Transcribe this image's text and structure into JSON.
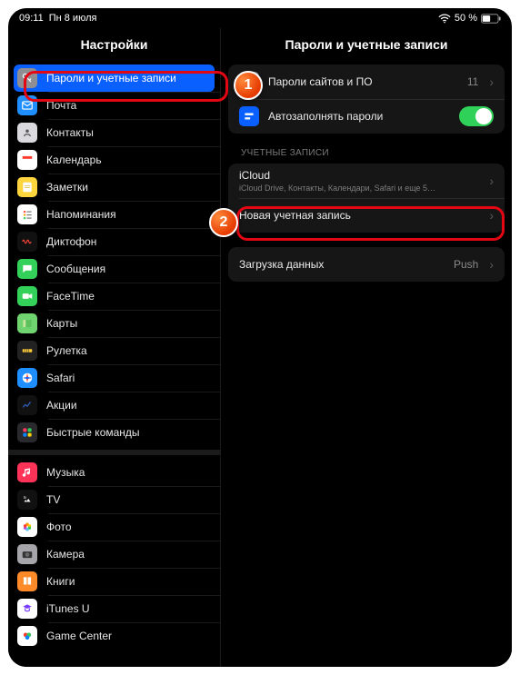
{
  "status": {
    "time": "09:11",
    "date": "Пн 8 июля",
    "battery": "50 %"
  },
  "sidebar": {
    "title": "Настройки",
    "items": [
      {
        "label": "Пароли и учетные записи",
        "icon": "key",
        "bg": "#8e8e93",
        "selected": true
      },
      {
        "label": "Почта",
        "icon": "mail",
        "bg": "#1f8fff"
      },
      {
        "label": "Контакты",
        "icon": "contacts",
        "bg": "#d9d9de"
      },
      {
        "label": "Календарь",
        "icon": "calendar",
        "bg": "#ffffff"
      },
      {
        "label": "Заметки",
        "icon": "notes",
        "bg": "#ffd53d"
      },
      {
        "label": "Напоминания",
        "icon": "reminders",
        "bg": "#ffffff"
      },
      {
        "label": "Диктофон",
        "icon": "voice",
        "bg": "#111111"
      },
      {
        "label": "Сообщения",
        "icon": "messages",
        "bg": "#33d15a"
      },
      {
        "label": "FaceTime",
        "icon": "facetime",
        "bg": "#33d15a"
      },
      {
        "label": "Карты",
        "icon": "maps",
        "bg": "#6fd36f"
      },
      {
        "label": "Рулетка",
        "icon": "measure",
        "bg": "#222222"
      },
      {
        "label": "Safari",
        "icon": "safari",
        "bg": "#1f8fff"
      },
      {
        "label": "Акции",
        "icon": "stocks",
        "bg": "#111111"
      },
      {
        "label": "Быстрые команды",
        "icon": "shortcuts",
        "bg": "#2a2a2e"
      }
    ],
    "items2": [
      {
        "label": "Музыка",
        "icon": "music",
        "bg": "#ff3358"
      },
      {
        "label": "TV",
        "icon": "tv",
        "bg": "#111111"
      },
      {
        "label": "Фото",
        "icon": "photos",
        "bg": "#ffffff"
      },
      {
        "label": "Камера",
        "icon": "camera",
        "bg": "#a6a6aa"
      },
      {
        "label": "Книги",
        "icon": "books",
        "bg": "#ff8a2a"
      },
      {
        "label": "iTunes U",
        "icon": "itunesu",
        "bg": "#ffffff"
      },
      {
        "label": "Game Center",
        "icon": "game",
        "bg": "#ffffff"
      }
    ]
  },
  "detail": {
    "title": "Пароли и учетные записи",
    "group1": [
      {
        "label": "Пароли сайтов и ПО",
        "icon": "key",
        "ibg": "#8e8e93",
        "value": "11",
        "chevron": true
      },
      {
        "label": "Автозаполнять пароли",
        "icon": "fill",
        "ibg": "#0a60ff",
        "toggle": true
      }
    ],
    "section_accounts": "УЧЕТНЫЕ ЗАПИСИ",
    "group2": [
      {
        "label": "iCloud",
        "sub": "iCloud Drive, Контакты, Календари, Safari и еще 5…",
        "chevron": true
      },
      {
        "label": "Новая учетная запись",
        "chevron": true
      }
    ],
    "group3": [
      {
        "label": "Загрузка данных",
        "value": "Push",
        "chevron": true
      }
    ]
  },
  "annot": {
    "m1": "1",
    "m2": "2"
  }
}
